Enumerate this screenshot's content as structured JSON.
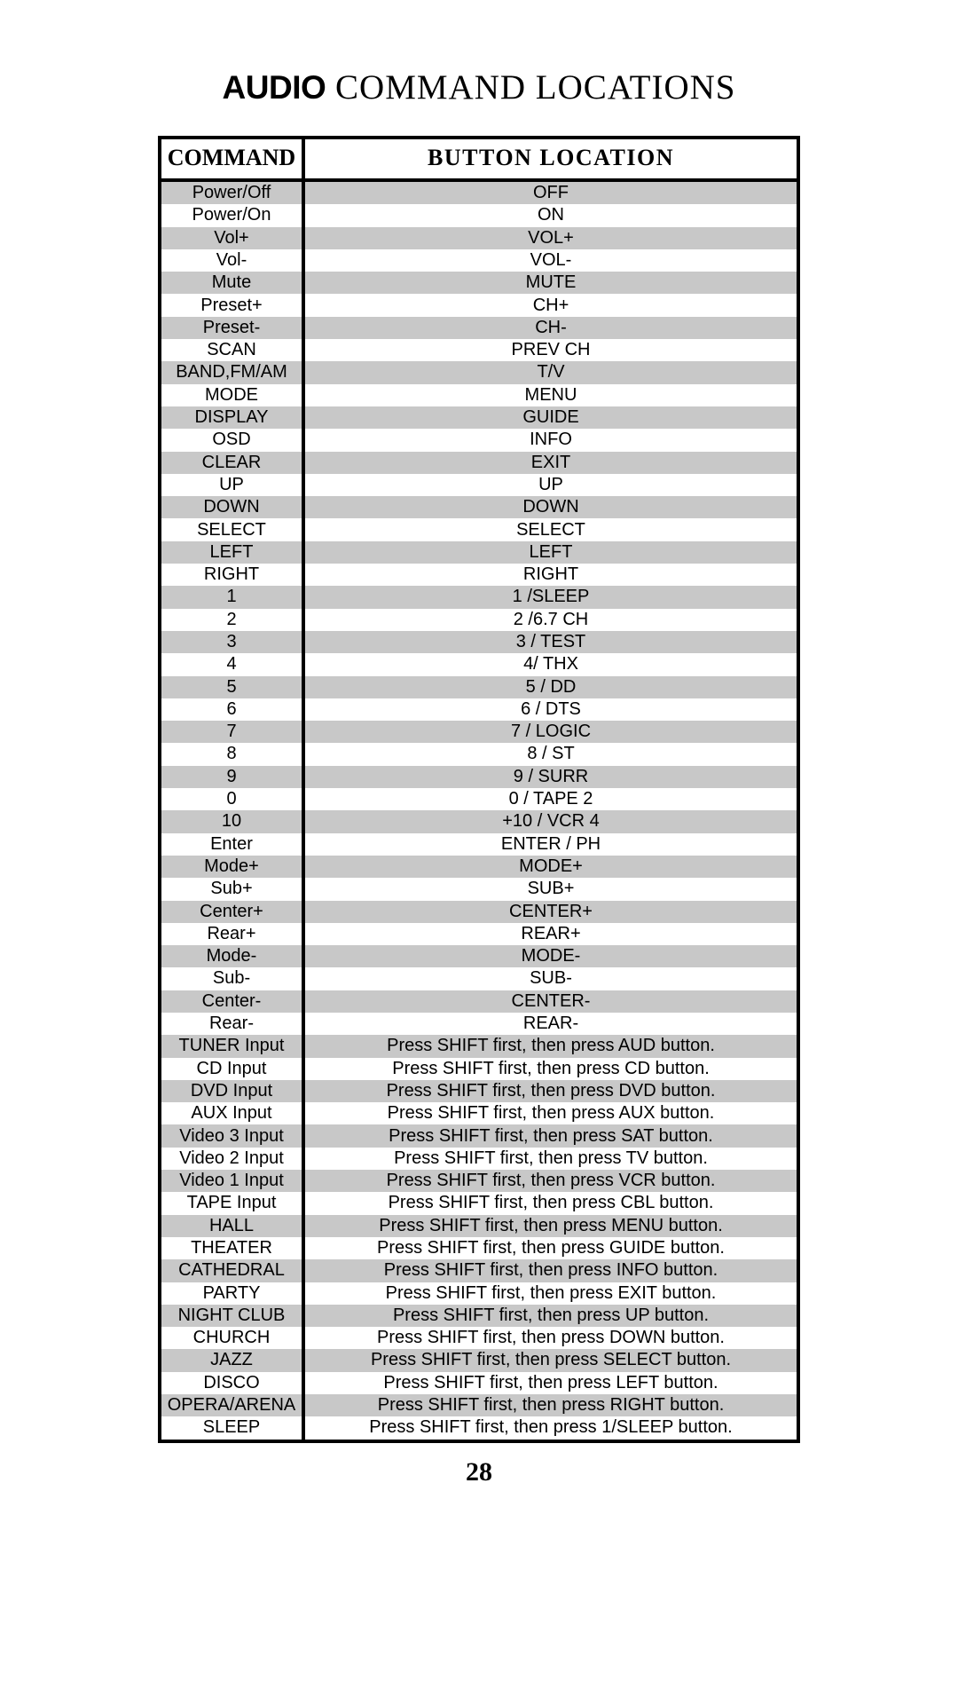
{
  "document": {
    "title_bold": "AUDIO",
    "title_rest": " COMMAND LOCATIONS",
    "page_number": "28"
  },
  "table": {
    "headers": {
      "command": "COMMAND",
      "button_location": "BUTTON LOCATION"
    },
    "colors": {
      "shade_row": "#c8c8c8",
      "plain_row": "#ffffff",
      "border": "#000000",
      "text": "#000000"
    },
    "rows": [
      {
        "command": "Power/Off",
        "location": "OFF"
      },
      {
        "command": "Power/On",
        "location": "ON"
      },
      {
        "command": "Vol+",
        "location": "VOL+"
      },
      {
        "command": "Vol-",
        "location": "VOL-"
      },
      {
        "command": "Mute",
        "location": "MUTE"
      },
      {
        "command": "Preset+",
        "location": "CH+"
      },
      {
        "command": "Preset-",
        "location": "CH-"
      },
      {
        "command": "SCAN",
        "location": "PREV CH"
      },
      {
        "command": "BAND,FM/AM",
        "location": "T/V"
      },
      {
        "command": "MODE",
        "location": "MENU"
      },
      {
        "command": "DISPLAY",
        "location": "GUIDE"
      },
      {
        "command": "OSD",
        "location": "INFO"
      },
      {
        "command": "CLEAR",
        "location": "EXIT"
      },
      {
        "command": "UP",
        "location": "UP"
      },
      {
        "command": "DOWN",
        "location": "DOWN"
      },
      {
        "command": "SELECT",
        "location": "SELECT"
      },
      {
        "command": "LEFT",
        "location": "LEFT"
      },
      {
        "command": "RIGHT",
        "location": "RIGHT"
      },
      {
        "command": "1",
        "location": "1 /SLEEP"
      },
      {
        "command": "2",
        "location": "2 /6.7 CH"
      },
      {
        "command": "3",
        "location": "3 / TEST"
      },
      {
        "command": "4",
        "location": "4/ THX"
      },
      {
        "command": "5",
        "location": "5 / DD"
      },
      {
        "command": "6",
        "location": "6 / DTS"
      },
      {
        "command": "7",
        "location": "7 / LOGIC"
      },
      {
        "command": "8",
        "location": "8 / ST"
      },
      {
        "command": "9",
        "location": "9 / SURR"
      },
      {
        "command": "0",
        "location": "0 / TAPE 2"
      },
      {
        "command": "10",
        "location": "+10 / VCR 4"
      },
      {
        "command": "Enter",
        "location": "ENTER / PH"
      },
      {
        "command": "Mode+",
        "location": "MODE+"
      },
      {
        "command": "Sub+",
        "location": "SUB+"
      },
      {
        "command": "Center+",
        "location": "CENTER+"
      },
      {
        "command": "Rear+",
        "location": "REAR+"
      },
      {
        "command": "Mode-",
        "location": "MODE-"
      },
      {
        "command": "Sub-",
        "location": "SUB-"
      },
      {
        "command": "Center-",
        "location": "CENTER-"
      },
      {
        "command": "Rear-",
        "location": "REAR-"
      },
      {
        "command": "TUNER Input",
        "location": "Press SHIFT first, then press AUD button."
      },
      {
        "command": "CD Input",
        "location": "Press SHIFT first, then press CD button."
      },
      {
        "command": "DVD Input",
        "location": "Press SHIFT first, then press DVD button."
      },
      {
        "command": "AUX Input",
        "location": "Press SHIFT first, then press AUX button."
      },
      {
        "command": "Video 3 Input",
        "location": "Press SHIFT first, then press SAT button."
      },
      {
        "command": "Video 2 Input",
        "location": "Press SHIFT first, then press TV button."
      },
      {
        "command": "Video 1 Input",
        "location": "Press SHIFT first, then press VCR button."
      },
      {
        "command": "TAPE Input",
        "location": "Press SHIFT first, then press CBL button."
      },
      {
        "command": "HALL",
        "location": "Press SHIFT first, then press MENU button."
      },
      {
        "command": "THEATER",
        "location": "Press SHIFT first, then press GUIDE button."
      },
      {
        "command": "CATHEDRAL",
        "location": "Press SHIFT first, then press INFO button."
      },
      {
        "command": "PARTY",
        "location": "Press SHIFT first, then press EXIT button."
      },
      {
        "command": "NIGHT CLUB",
        "location": "Press SHIFT first, then press UP button."
      },
      {
        "command": "CHURCH",
        "location": "Press SHIFT first, then press DOWN button."
      },
      {
        "command": "JAZZ",
        "location": "Press SHIFT first, then press SELECT button."
      },
      {
        "command": "DISCO",
        "location": "Press SHIFT first, then press LEFT button."
      },
      {
        "command": "OPERA/ARENA",
        "location": "Press SHIFT first, then press RIGHT button."
      },
      {
        "command": "SLEEP",
        "location": "Press SHIFT first, then press 1/SLEEP button."
      }
    ]
  }
}
